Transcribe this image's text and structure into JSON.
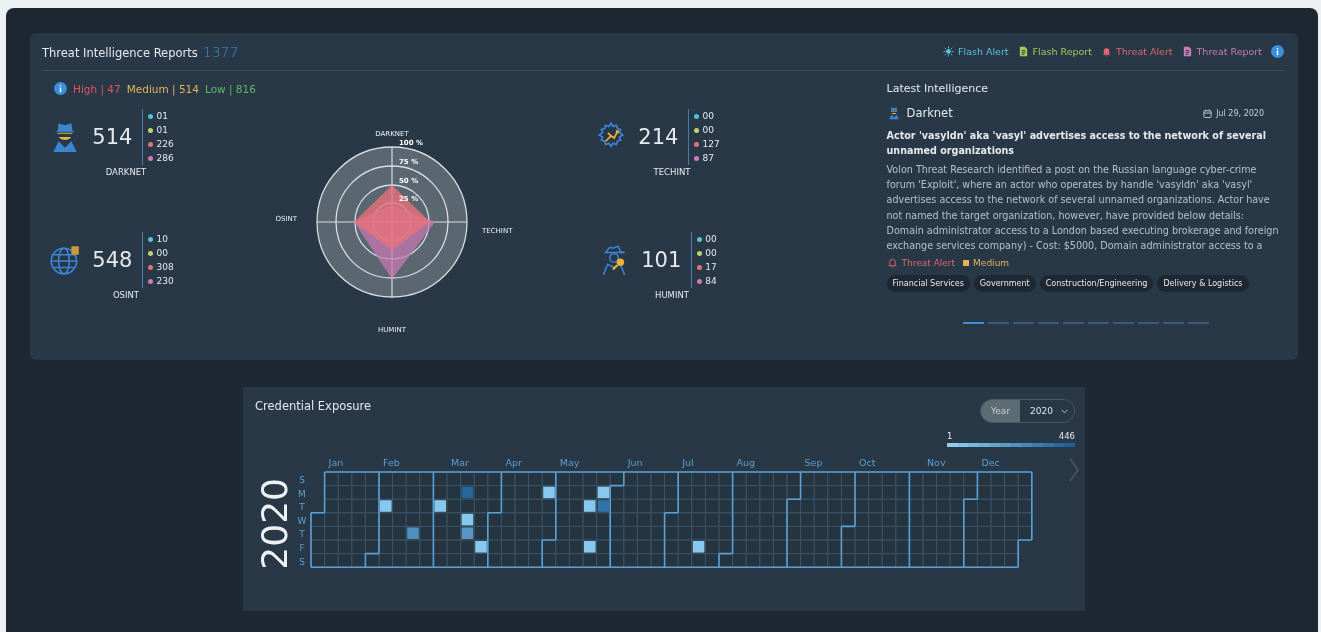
{
  "reports": {
    "title": "Threat Intelligence Reports",
    "total": "1377",
    "legend": [
      {
        "label": "Flash Alert",
        "kind": "bulb",
        "color": "#5bc0de"
      },
      {
        "label": "Flash Report",
        "kind": "report",
        "color": "#a8c85c"
      },
      {
        "label": "Threat Alert",
        "kind": "bell",
        "color": "#e2646e"
      },
      {
        "label": "Threat Report",
        "kind": "report",
        "color": "#c97bb4"
      }
    ],
    "severity": [
      {
        "label": "High | 47",
        "color": "#e5535c"
      },
      {
        "label": "Medium | 514",
        "color": "#e2b45a"
      },
      {
        "label": "Low | 816",
        "color": "#5fb86a"
      }
    ],
    "sources": [
      {
        "name": "DARKNET",
        "kind": "spy",
        "total": "514",
        "counts": [
          {
            "value": "01",
            "color": "#4fc3dc"
          },
          {
            "value": "01",
            "color": "#bfd36a"
          },
          {
            "value": "226",
            "color": "#e8707a"
          },
          {
            "value": "286",
            "color": "#d07ab8"
          }
        ]
      },
      {
        "name": "TECHINT",
        "kind": "gear",
        "total": "214",
        "counts": [
          {
            "value": "00",
            "color": "#4fc3dc"
          },
          {
            "value": "00",
            "color": "#bfd36a"
          },
          {
            "value": "127",
            "color": "#e8707a"
          },
          {
            "value": "87",
            "color": "#d07ab8"
          }
        ]
      },
      {
        "name": "OSINT",
        "kind": "globe",
        "total": "548",
        "counts": [
          {
            "value": "10",
            "color": "#4fc3dc"
          },
          {
            "value": "00",
            "color": "#bfd36a"
          },
          {
            "value": "308",
            "color": "#e8707a"
          },
          {
            "value": "230",
            "color": "#d07ab8"
          }
        ]
      },
      {
        "name": "HUMINT",
        "kind": "agent",
        "total": "101",
        "counts": [
          {
            "value": "00",
            "color": "#4fc3dc"
          },
          {
            "value": "00",
            "color": "#bfd36a"
          },
          {
            "value": "17",
            "color": "#e8707a"
          },
          {
            "value": "84",
            "color": "#d07ab8"
          }
        ]
      }
    ],
    "radar": {
      "axes": [
        "DARKNET",
        "TECHINT",
        "HUMINT",
        "OSINT"
      ],
      "ticks": [
        "100 %",
        "75 %",
        "50 %",
        "25 %"
      ]
    }
  },
  "latest": {
    "heading": "Latest Intelligence",
    "source": "Darknet",
    "date": "Jul 29, 2020",
    "title": "Actor 'vasyldn' aka 'vasyl' advertises access to the network of several unnamed organizations",
    "body": "Volon Threat Research identified a post on the Russian language cyber-crime forum 'Exploit', where an actor who operates by handle 'vasyldn' aka 'vasyl' advertises access to the network of several unnamed organizations. Actor have not named the target organization, however, have provided below details: Domain administrator access to a London based executing brokerage and foreign exchange services company) - Cost: $5000, Domain administrator access to a",
    "alert": "Threat Alert",
    "severity": {
      "label": "Medium",
      "color": "#e2b45a"
    },
    "tags": [
      "Financial Services",
      "Government",
      "Construction/Engineering",
      "Delivery & Logistics"
    ],
    "pager": [
      {
        "selected": true
      },
      {
        "selected": false
      },
      {
        "selected": false
      },
      {
        "selected": false
      },
      {
        "selected": false
      },
      {
        "selected": false
      },
      {
        "selected": false
      },
      {
        "selected": false
      },
      {
        "selected": false
      },
      {
        "selected": false
      }
    ]
  },
  "credentials": {
    "title": "Credential Exposure",
    "toggle": {
      "label": "Year",
      "selected": true
    },
    "year_select": "2020",
    "scale_min": "1",
    "scale_max": "446",
    "year": "2020",
    "months": [
      "Jan",
      "Feb",
      "Mar",
      "Apr",
      "May",
      "Jun",
      "Jul",
      "Aug",
      "Sep",
      "Oct",
      "Nov",
      "Dec"
    ],
    "days": [
      "S",
      "M",
      "T",
      "W",
      "T",
      "F",
      "S"
    ]
  }
}
